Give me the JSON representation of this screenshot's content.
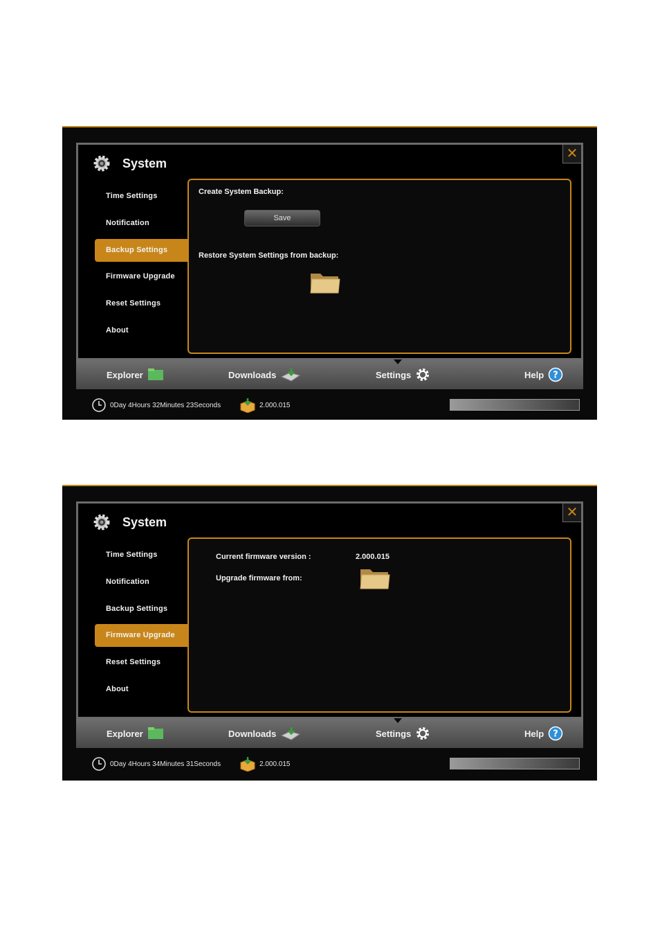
{
  "shot1": {
    "title": "System",
    "close_icon": "close-icon",
    "menu": [
      "Time Settings",
      "Notification",
      "Backup Settings",
      "Firmware Upgrade",
      "Reset Settings",
      "About"
    ],
    "active_menu": "Backup Settings",
    "content": {
      "create_backup_label": "Create System Backup:",
      "save_button": "Save",
      "restore_label": "Restore System Settings from backup:"
    },
    "nav": {
      "explorer": "Explorer",
      "downloads": "Downloads",
      "settings": "Settings",
      "help": "Help"
    },
    "status": {
      "uptime": "0Day 4Hours 32Minutes 23Seconds",
      "version": "2.000.015"
    }
  },
  "shot2": {
    "title": "System",
    "close_icon": "close-icon",
    "menu": [
      "Time Settings",
      "Notification",
      "Backup Settings",
      "Firmware Upgrade",
      "Reset Settings",
      "About"
    ],
    "active_menu": "Firmware Upgrade",
    "content": {
      "current_fw_label": "Current firmware version :",
      "current_fw_value": "2.000.015",
      "upgrade_label": "Upgrade firmware from:"
    },
    "nav": {
      "explorer": "Explorer",
      "downloads": "Downloads",
      "settings": "Settings",
      "help": "Help"
    },
    "status": {
      "uptime": "0Day 4Hours 34Minutes 31Seconds",
      "version": "2.000.015"
    }
  },
  "colors": {
    "accent": "#c8861a",
    "panel_border": "#6b6b6b",
    "background": "#0a0a0a"
  }
}
